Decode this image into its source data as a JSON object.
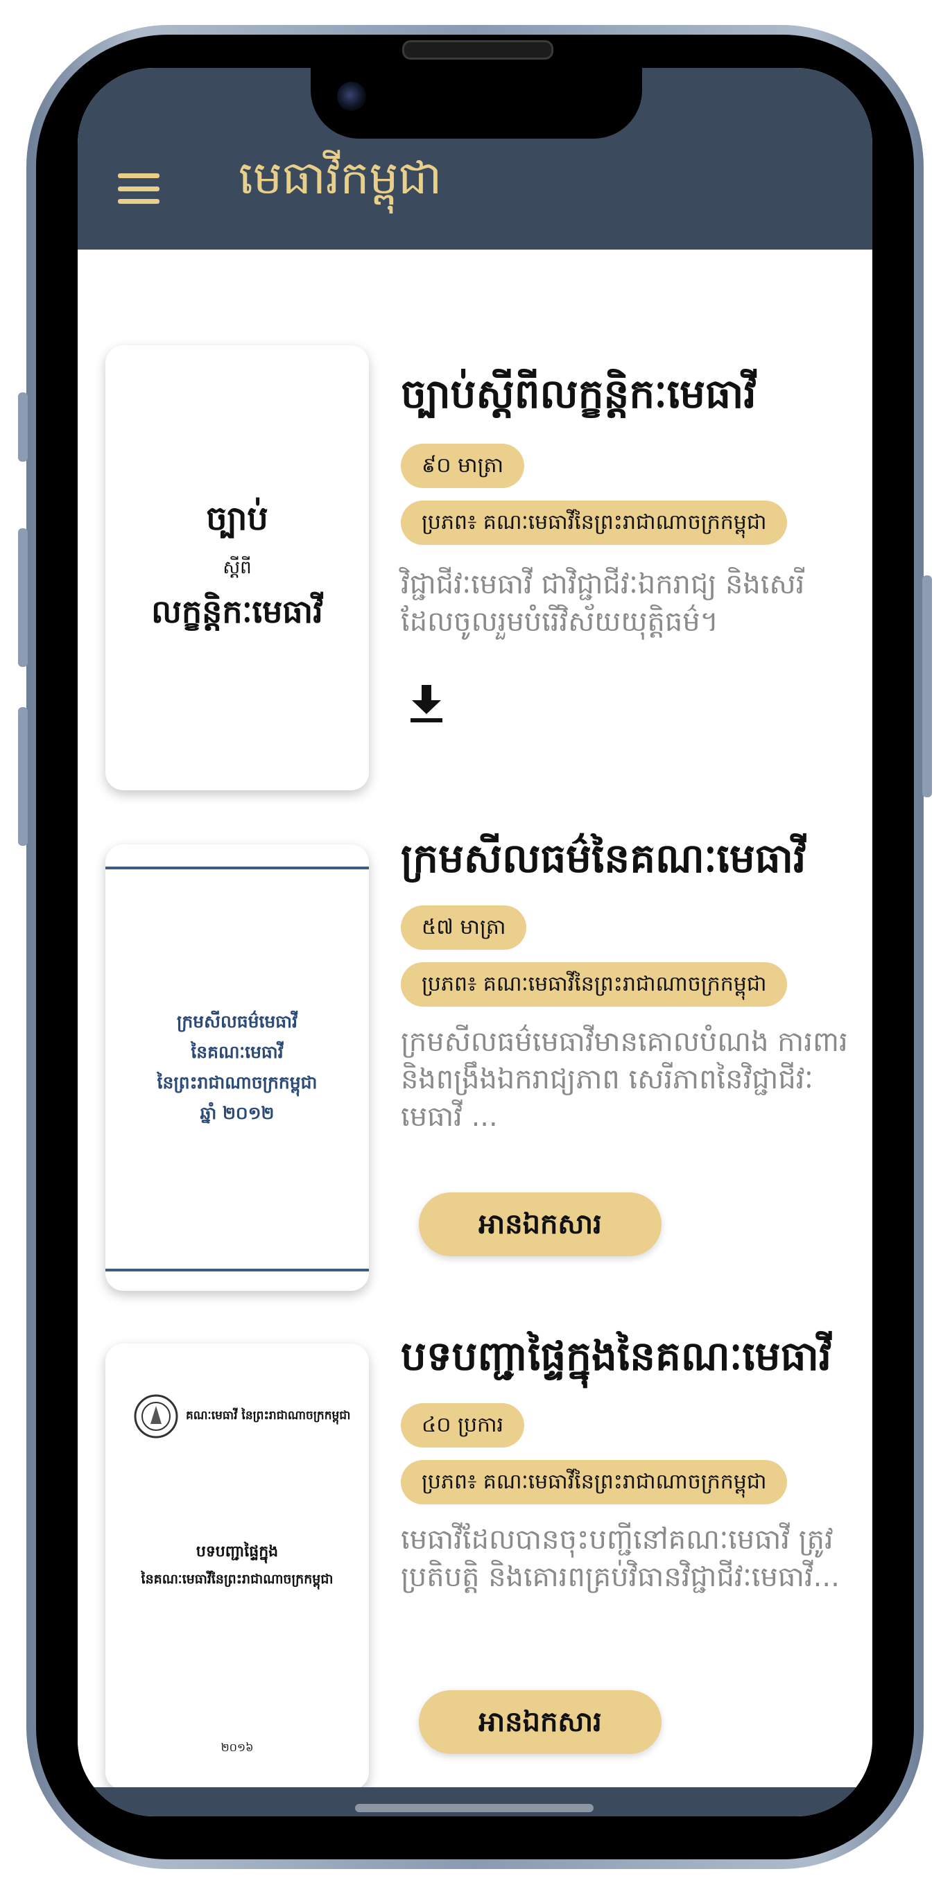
{
  "app": {
    "title": "មេធាវីកម្ពុជា"
  },
  "colors": {
    "appbar": "#3b4a5d",
    "accent": "#ebcf8d",
    "title_gold": "#e8cf8a"
  },
  "documents": [
    {
      "cover": {
        "line1": "ច្បាប់",
        "line2": "ស្ដីពី",
        "line3": "លក្ខន្តិកៈមេធាវី"
      },
      "title": "ច្បាប់ស្តីពីលក្ខន្តិកៈមេធាវី",
      "count": "៩០ មាត្រា",
      "source": "ប្រភព៖ គណៈមេធាវីនៃព្រះរាជាណាចក្រកម្ពុជា",
      "description": "វិជ្ជាជីវៈមេធាវី ជាវិជ្ជាជីវៈឯករាជ្យ និងសេរី ដែលចូលរួមបំរើវិស័យយុត្តិធម៌។",
      "action_icon": "download-icon"
    },
    {
      "cover": {
        "line1": "ក្រមសីលធម៌មេធាវី",
        "line2": "នៃគណៈមេធាវី",
        "line3": "នៃព្រះរាជាណាចក្រកម្ពុជា",
        "line4": "ឆ្នាំ ២០១២"
      },
      "title": "ក្រមសីលធម៌នៃគណៈមេធាវី",
      "count": "៥៧ មាត្រា",
      "source": "ប្រភព៖ គណៈមេធាវីនៃព្រះរាជាណាចក្រកម្ពុជា",
      "description": "ក្រមសីលធម៌មេធាវីមានគោលបំណង ការពារនិងពង្រឹងឯករាជ្យភាព សេរីភាពនៃវិជ្ជាជីវៈមេធាវី ...",
      "button_label": "អានឯកសារ"
    },
    {
      "cover": {
        "header": "គណៈមេធាវី នៃព្រះរាជាណាចក្រកម្ពុជា",
        "line1": "បទបញ្ជាផ្ទៃក្នុង",
        "line2": "នៃគណៈមេធាវីនៃព្រះរាជាណាចក្រកម្ពុជា",
        "year": "២០១៦"
      },
      "title": "បទបញ្ជាផ្ទៃក្នុងនៃគណៈមេធាវី",
      "count": "៤០ ប្រការ",
      "source": "ប្រភព៖ គណៈមេធាវីនៃព្រះរាជាណាចក្រកម្ពុជា",
      "description": "មេធាវីដែលបានចុះបញ្ជីនៅគណៈមេធាវី ត្រូវប្រតិបត្តិ និងគោរពគ្រប់វិធានវិជ្ជាជីវៈមេធាវី...",
      "button_label": "អានឯកសារ"
    }
  ]
}
